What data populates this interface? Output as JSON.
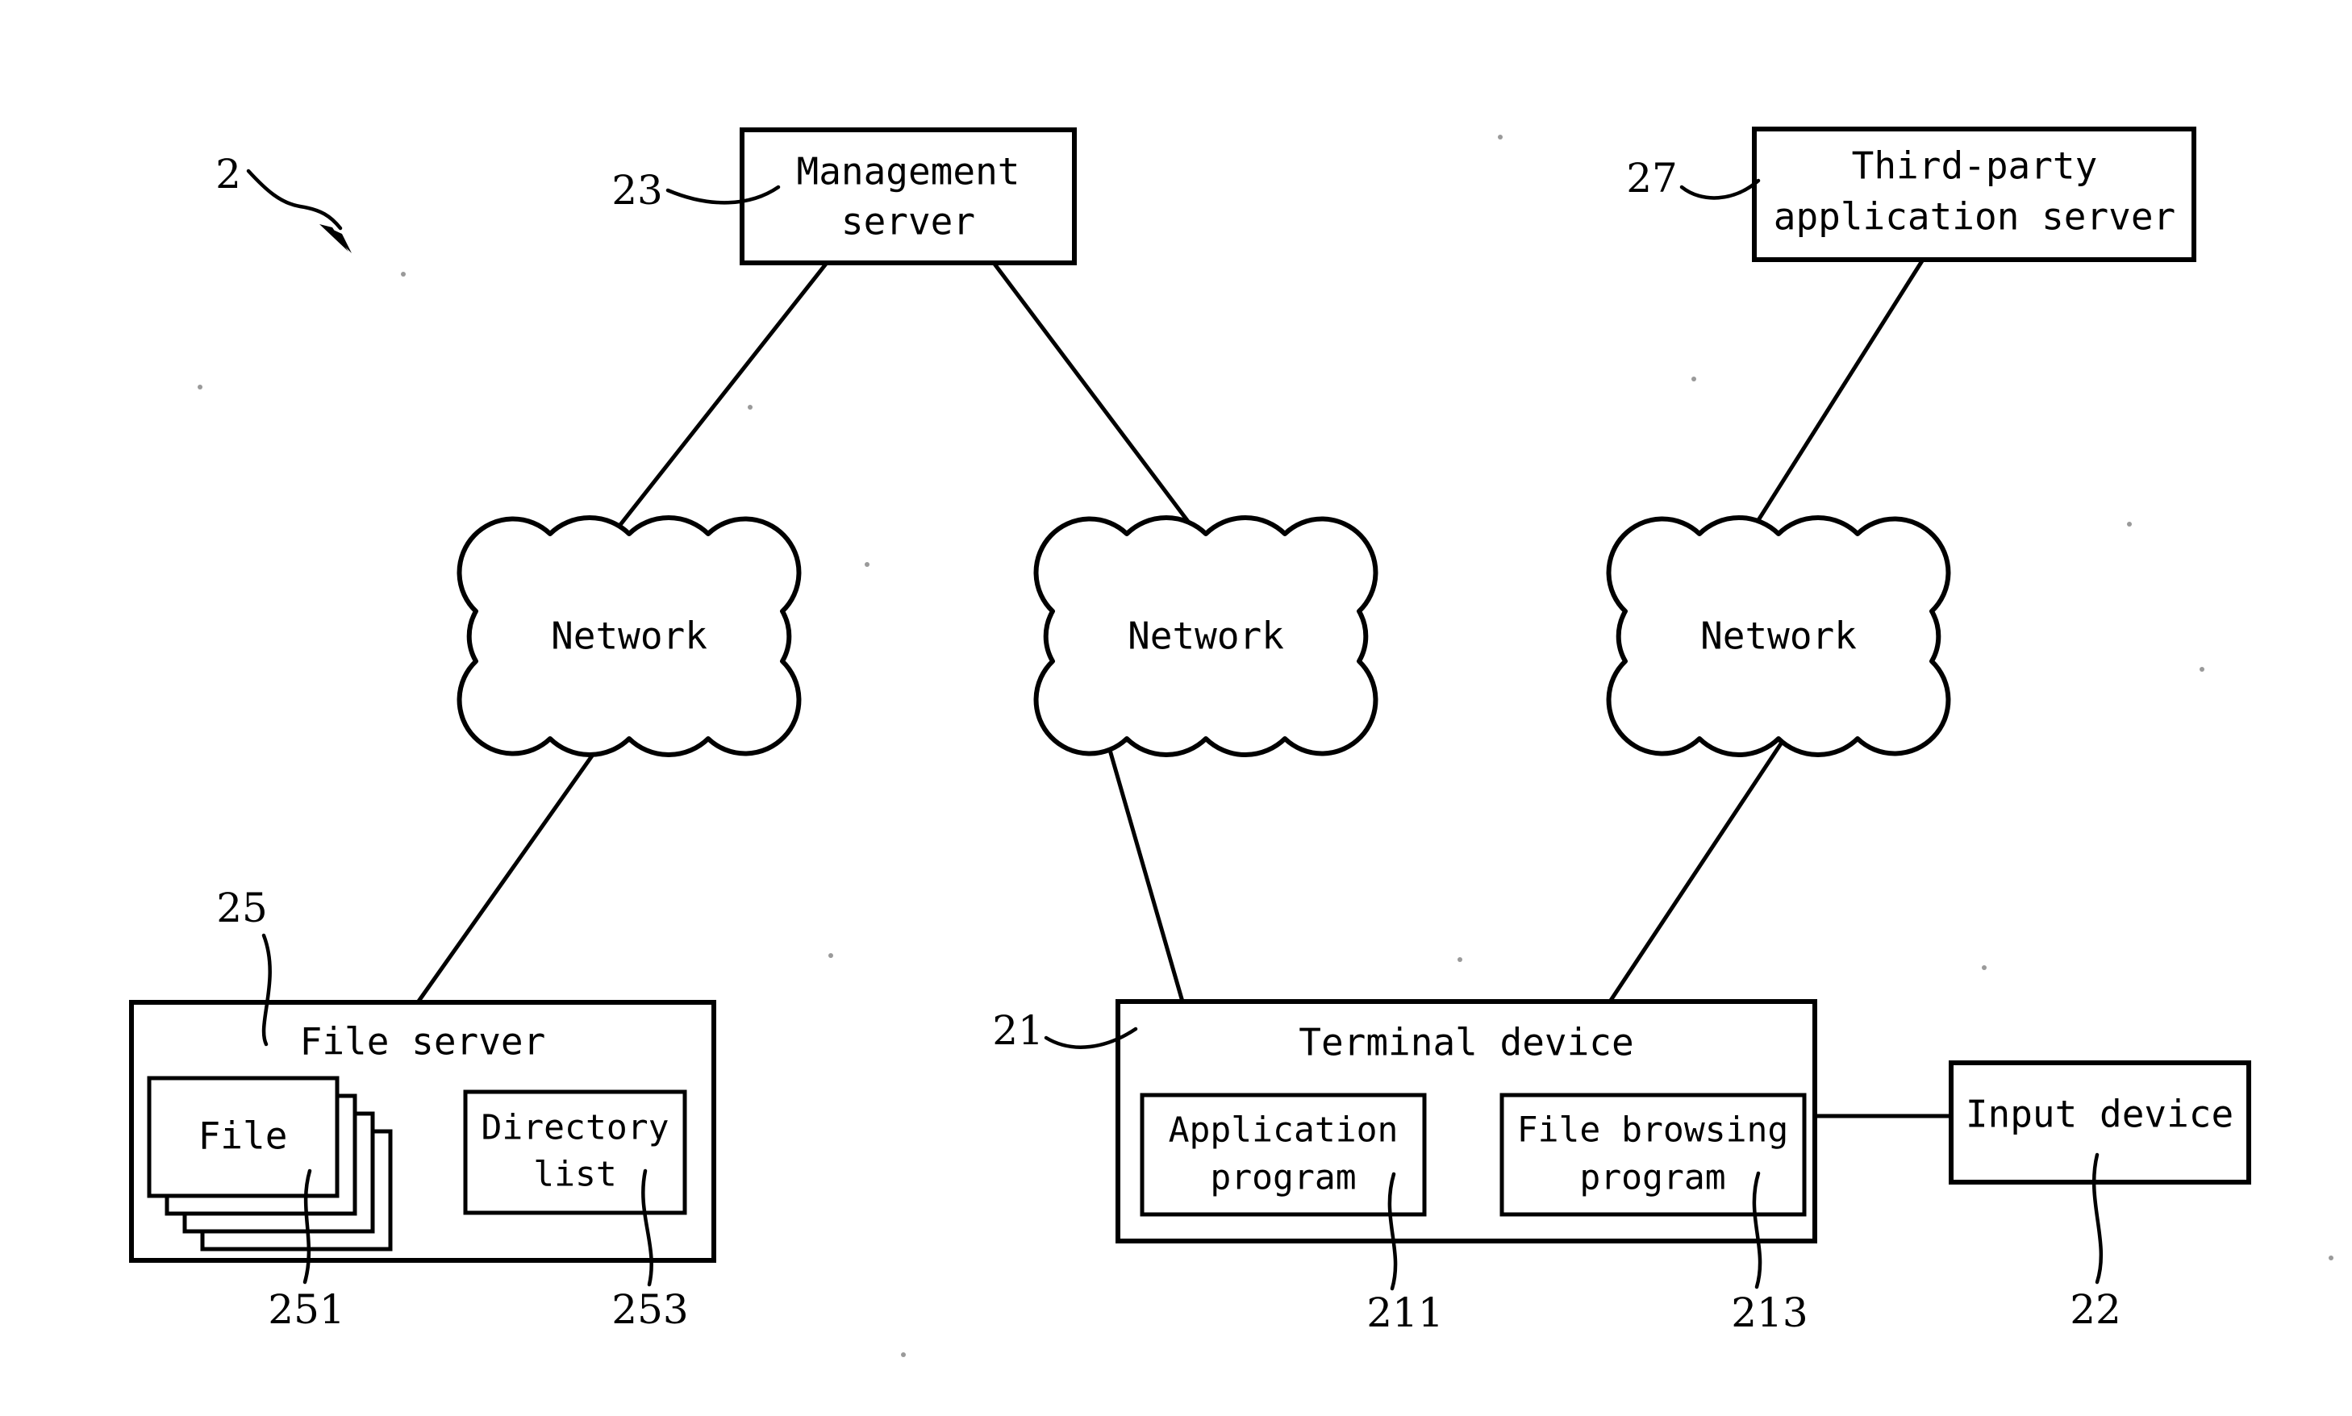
{
  "figure": {
    "number": "2",
    "kind": "patent-system-architecture-diagram",
    "background_color": "#ffffff",
    "line_color": "#000000"
  },
  "nodes": {
    "management_server": {
      "label_line1": "Management",
      "label_line2": "server",
      "ref": "23",
      "shape": "rectangle"
    },
    "third_party_server": {
      "label_line1": "Third-party",
      "label_line2": "application server",
      "ref": "27",
      "shape": "rectangle"
    },
    "network_left": {
      "label": "Network",
      "shape": "cloud"
    },
    "network_center": {
      "label": "Network",
      "shape": "cloud"
    },
    "network_right": {
      "label": "Network",
      "shape": "cloud"
    },
    "file_server": {
      "label": "File server",
      "ref": "25",
      "shape": "rectangle"
    },
    "file_stack": {
      "label": "File",
      "ref": "251",
      "shape": "stacked-rectangles",
      "stack_count": 4
    },
    "directory_list": {
      "label_line1": "Directory",
      "label_line2": "list",
      "ref": "253",
      "shape": "rectangle"
    },
    "terminal_device": {
      "label": "Terminal device",
      "ref": "21",
      "shape": "rectangle"
    },
    "application_program": {
      "label_line1": "Application",
      "label_line2": "program",
      "ref": "211",
      "shape": "rectangle"
    },
    "file_browsing_program": {
      "label_line1": "File browsing",
      "label_line2": "program",
      "ref": "213",
      "shape": "rectangle"
    },
    "input_device": {
      "label": "Input device",
      "ref": "22",
      "shape": "rectangle"
    }
  },
  "connections": [
    {
      "from": "management_server",
      "to": "network_left"
    },
    {
      "from": "management_server",
      "to": "network_center"
    },
    {
      "from": "third_party_server",
      "to": "network_right"
    },
    {
      "from": "network_left",
      "to": "file_server"
    },
    {
      "from": "network_center",
      "to": "terminal_device"
    },
    {
      "from": "network_right",
      "to": "terminal_device"
    },
    {
      "from": "terminal_device",
      "to": "input_device"
    }
  ]
}
